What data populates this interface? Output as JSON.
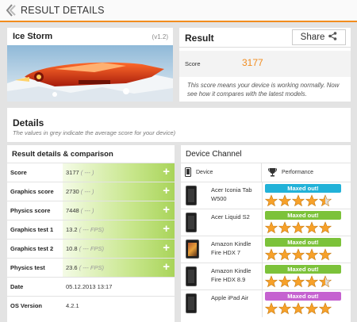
{
  "header": {
    "title": "RESULT DETAILS"
  },
  "benchmark": {
    "name": "Ice Storm",
    "version": "(v1.2)"
  },
  "result": {
    "title": "Result",
    "share_label": "Share",
    "score_label": "Score",
    "score_value": "3177",
    "description": "This score means your device is working normally. Now see how it compares with the latest models."
  },
  "details": {
    "title": "Details",
    "subtitle": "The values in grey indicate the average score for your device)",
    "left_heading": "Result details & comparison",
    "right_heading": "Device Channel",
    "rows": [
      {
        "label": "Score",
        "value": "3177",
        "avg": "( --- )"
      },
      {
        "label": "Graphics score",
        "value": "2730",
        "avg": "( --- )"
      },
      {
        "label": "Physics score",
        "value": "7448",
        "avg": "( --- )"
      },
      {
        "label": "Graphics test 1",
        "value": "13.2",
        "avg": "( --- FPS)"
      },
      {
        "label": "Graphics test 2",
        "value": "10.8",
        "avg": "( --- FPS)"
      },
      {
        "label": "Physics test",
        "value": "23.6",
        "avg": "( --- FPS)"
      },
      {
        "label": "Date",
        "value": "05.12.2013 13:17"
      },
      {
        "label": "OS Version",
        "value": "4.2.1"
      }
    ],
    "plus_symbol": "+",
    "device_col_label": "Device",
    "performance_col_label": "Performance",
    "devices": [
      {
        "name": "Acer Iconia Tab W500",
        "badge": "Maxed out!",
        "badge_color": "#22b2d8",
        "stars": 4.5
      },
      {
        "name": "Acer Liquid S2",
        "badge": "Maxed out!",
        "badge_color": "#7cc23a",
        "stars": 5
      },
      {
        "name": "Amazon Kindle Fire HDX 7",
        "badge": "Maxed out!",
        "badge_color": "#7cc23a",
        "stars": 5
      },
      {
        "name": "Amazon Kindle Fire HDX 8.9",
        "badge": "Maxed out!",
        "badge_color": "#7cc23a",
        "stars": 4.5
      },
      {
        "name": "Apple iPad Air",
        "badge": "Maxed out!",
        "badge_color": "#c562d0",
        "stars": 5
      }
    ]
  },
  "colors": {
    "accent": "#f28c1e",
    "bar_green": "#a9d45a",
    "star": "#f7a12a"
  }
}
